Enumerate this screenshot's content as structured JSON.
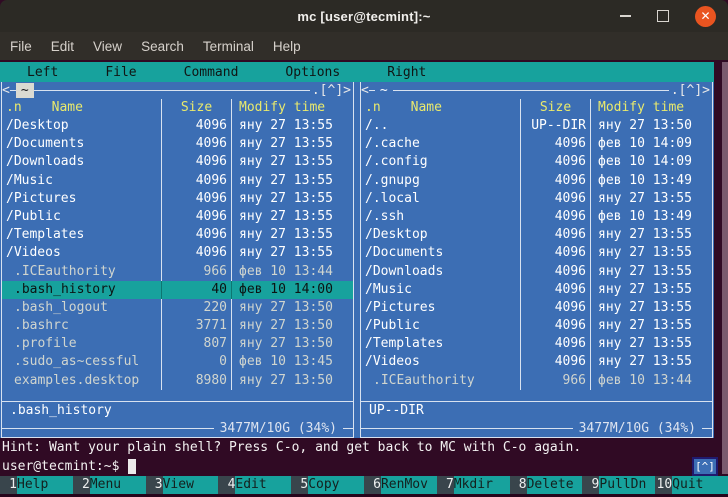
{
  "window": {
    "title": "mc [user@tecmint]:~",
    "controls": {
      "minimize": "minimize",
      "maximize": "maximize",
      "close": "close"
    }
  },
  "menubar": {
    "items": [
      "File",
      "Edit",
      "View",
      "Search",
      "Terminal",
      "Help"
    ]
  },
  "mc_menu": {
    "items": [
      "Left",
      "File",
      "Command",
      "Options",
      "Right"
    ]
  },
  "headers": {
    "sort": ".n",
    "name": "Name",
    "size": "Size",
    "modify": "Modify time"
  },
  "panels": {
    "left": {
      "path": "~",
      "active": true,
      "corner": "<",
      "sort_indicator": ".[^]>",
      "rows": [
        {
          "name": "/Desktop",
          "size": "4096",
          "modify": "яну 27 13:55",
          "type": "dir",
          "selected": false
        },
        {
          "name": "/Documents",
          "size": "4096",
          "modify": "яну 27 13:55",
          "type": "dir",
          "selected": false
        },
        {
          "name": "/Downloads",
          "size": "4096",
          "modify": "яну 27 13:55",
          "type": "dir",
          "selected": false
        },
        {
          "name": "/Music",
          "size": "4096",
          "modify": "яну 27 13:55",
          "type": "dir",
          "selected": false
        },
        {
          "name": "/Pictures",
          "size": "4096",
          "modify": "яну 27 13:55",
          "type": "dir",
          "selected": false
        },
        {
          "name": "/Public",
          "size": "4096",
          "modify": "яну 27 13:55",
          "type": "dir",
          "selected": false
        },
        {
          "name": "/Templates",
          "size": "4096",
          "modify": "яну 27 13:55",
          "type": "dir",
          "selected": false
        },
        {
          "name": "/Videos",
          "size": "4096",
          "modify": "яну 27 13:55",
          "type": "dir",
          "selected": false
        },
        {
          "name": ".ICEauthority",
          "size": "966",
          "modify": "фев 10 13:44",
          "type": "file",
          "selected": false
        },
        {
          "name": ".bash_history",
          "size": "40",
          "modify": "фев 10 14:00",
          "type": "file",
          "selected": true
        },
        {
          "name": ".bash_logout",
          "size": "220",
          "modify": "яну 27 13:50",
          "type": "file",
          "selected": false
        },
        {
          "name": ".bashrc",
          "size": "3771",
          "modify": "яну 27 13:50",
          "type": "file",
          "selected": false
        },
        {
          "name": ".profile",
          "size": "807",
          "modify": "яну 27 13:50",
          "type": "file",
          "selected": false
        },
        {
          "name": ".sudo_as~cessful",
          "size": "0",
          "modify": "фев 10 13:45",
          "type": "file",
          "selected": false
        },
        {
          "name": "examples.desktop",
          "size": "8980",
          "modify": "яну 27 13:50",
          "type": "file",
          "selected": false
        }
      ],
      "status": ".bash_history",
      "free_space": "3477M/10G (34%)"
    },
    "right": {
      "path": "~",
      "active": false,
      "corner": "<",
      "sort_indicator": ".[^]>",
      "rows": [
        {
          "name": "/..",
          "size": "UP--DIR",
          "modify": "яну 27 13:50",
          "type": "dir",
          "selected": false
        },
        {
          "name": "/.cache",
          "size": "4096",
          "modify": "фев 10 14:09",
          "type": "dir",
          "selected": false
        },
        {
          "name": "/.config",
          "size": "4096",
          "modify": "фев 10 14:09",
          "type": "dir",
          "selected": false
        },
        {
          "name": "/.gnupg",
          "size": "4096",
          "modify": "фев 10 13:49",
          "type": "dir",
          "selected": false
        },
        {
          "name": "/.local",
          "size": "4096",
          "modify": "яну 27 13:55",
          "type": "dir",
          "selected": false
        },
        {
          "name": "/.ssh",
          "size": "4096",
          "modify": "фев 10 13:49",
          "type": "dir",
          "selected": false
        },
        {
          "name": "/Desktop",
          "size": "4096",
          "modify": "яну 27 13:55",
          "type": "dir",
          "selected": false
        },
        {
          "name": "/Documents",
          "size": "4096",
          "modify": "яну 27 13:55",
          "type": "dir",
          "selected": false
        },
        {
          "name": "/Downloads",
          "size": "4096",
          "modify": "яну 27 13:55",
          "type": "dir",
          "selected": false
        },
        {
          "name": "/Music",
          "size": "4096",
          "modify": "яну 27 13:55",
          "type": "dir",
          "selected": false
        },
        {
          "name": "/Pictures",
          "size": "4096",
          "modify": "яну 27 13:55",
          "type": "dir",
          "selected": false
        },
        {
          "name": "/Public",
          "size": "4096",
          "modify": "яну 27 13:55",
          "type": "dir",
          "selected": false
        },
        {
          "name": "/Templates",
          "size": "4096",
          "modify": "яну 27 13:55",
          "type": "dir",
          "selected": false
        },
        {
          "name": "/Videos",
          "size": "4096",
          "modify": "яну 27 13:55",
          "type": "dir",
          "selected": false
        },
        {
          "name": ".ICEauthority",
          "size": "966",
          "modify": "фев 10 13:44",
          "type": "file",
          "selected": false
        }
      ],
      "status": "UP--DIR",
      "free_space": "3477M/10G (34%)"
    }
  },
  "hint": "Hint: Want your plain shell? Press C-o, and get back to MC with C-o again.",
  "prompt": "user@tecmint:~$",
  "scroll_indicator": "[^]",
  "keybar": [
    {
      "num": "1",
      "label": "Help"
    },
    {
      "num": "2",
      "label": "Menu"
    },
    {
      "num": "3",
      "label": "View"
    },
    {
      "num": "4",
      "label": "Edit"
    },
    {
      "num": "5",
      "label": "Copy"
    },
    {
      "num": "6",
      "label": "RenMov"
    },
    {
      "num": "7",
      "label": "Mkdir"
    },
    {
      "num": "8",
      "label": "Delete"
    },
    {
      "num": "9",
      "label": "PullDn"
    },
    {
      "num": "10",
      "label": "Quit"
    }
  ],
  "colors": {
    "terminal_bg": "#300a24",
    "panel_blue": "#3c6eb4",
    "teal": "#17a29d",
    "line": "#d8e2f0",
    "yellow": "#eaea6c",
    "dir_text": "#ffffff",
    "file_text": "#d0d5cf",
    "titlebar_bg": "#2c2a25",
    "menubar_bg": "#312e29",
    "close_orange": "#e95420",
    "keybar_dark": "#39454c",
    "scrollbar": "#7a5a6e"
  }
}
